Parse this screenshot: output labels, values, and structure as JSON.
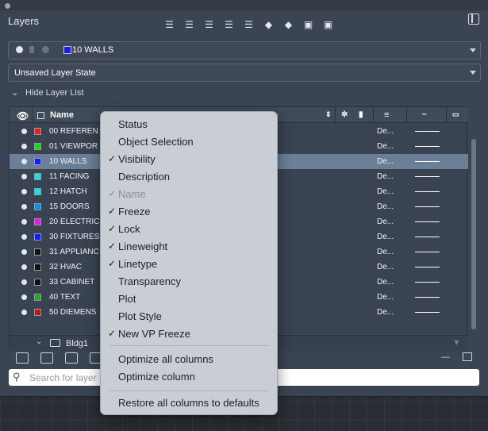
{
  "palette": {
    "title": "Layers",
    "toolbar_icons": [
      "new-layer-icon",
      "new-vp-layer-icon",
      "delete-layer-icon",
      "set-current-icon",
      "move-layer-icon",
      "freeze-vp-icon",
      "isolate-icon",
      "lock-icon",
      "unlock-icon"
    ],
    "current_layer": {
      "name": "10 WALLS",
      "color": "#1a1aff"
    },
    "layer_state": "Unsaved Layer State",
    "hide_list_label": "Hide Layer List"
  },
  "columns": {
    "name": "Name"
  },
  "layers": [
    {
      "name": "00 REFEREN",
      "color": "#e02424",
      "linetype": "De...",
      "selected": false
    },
    {
      "name": "01 VIEWPOR",
      "color": "#22d122",
      "linetype": "De...",
      "selected": false
    },
    {
      "name": "10 WALLS",
      "color": "#1a1aff",
      "linetype": "De...",
      "selected": true
    },
    {
      "name": "11 FACING",
      "color": "#1fe0e0",
      "linetype": "De...",
      "selected": false
    },
    {
      "name": "12 HATCH",
      "color": "#1fe0e0",
      "linetype": "De...",
      "selected": false
    },
    {
      "name": "15 DOORS",
      "color": "#1a88e0",
      "linetype": "De...",
      "selected": false
    },
    {
      "name": "20 ELECTRIC",
      "color": "#e020e0",
      "linetype": "De...",
      "selected": false
    },
    {
      "name": "30 FIXTURES",
      "color": "#1a1aff",
      "linetype": "De...",
      "selected": false
    },
    {
      "name": "31 APPLIANC",
      "color": "#111111",
      "linetype": "De...",
      "selected": false
    },
    {
      "name": "32 HVAC",
      "color": "#111111",
      "linetype": "De...",
      "selected": false
    },
    {
      "name": "33 CABINET",
      "color": "#111111",
      "linetype": "De...",
      "selected": false
    },
    {
      "name": "40 TEXT",
      "color": "#2e9e2e",
      "linetype": "De...",
      "selected": false
    },
    {
      "name": "50 DIEMENS",
      "color": "#b31d1d",
      "linetype": "De...",
      "selected": false
    }
  ],
  "group": {
    "name": "Bldg1"
  },
  "search": {
    "placeholder": "Search for layer"
  },
  "context_menu": {
    "items": [
      {
        "label": "Status",
        "checked": false,
        "disabled": false
      },
      {
        "label": "Object Selection",
        "checked": false,
        "disabled": false
      },
      {
        "label": "Visibility",
        "checked": true,
        "disabled": false
      },
      {
        "label": "Description",
        "checked": false,
        "disabled": false
      },
      {
        "label": "Name",
        "checked": true,
        "disabled": true
      },
      {
        "label": "Freeze",
        "checked": true,
        "disabled": false
      },
      {
        "label": "Lock",
        "checked": true,
        "disabled": false
      },
      {
        "label": "Lineweight",
        "checked": true,
        "disabled": false
      },
      {
        "label": "Linetype",
        "checked": true,
        "disabled": false
      },
      {
        "label": "Transparency",
        "checked": false,
        "disabled": false
      },
      {
        "label": "Plot",
        "checked": false,
        "disabled": false
      },
      {
        "label": "Plot Style",
        "checked": false,
        "disabled": false
      },
      {
        "label": "New VP Freeze",
        "checked": true,
        "disabled": false
      }
    ],
    "optimize_all": "Optimize all columns",
    "optimize_one": "Optimize column",
    "restore": "Restore all columns to defaults"
  }
}
